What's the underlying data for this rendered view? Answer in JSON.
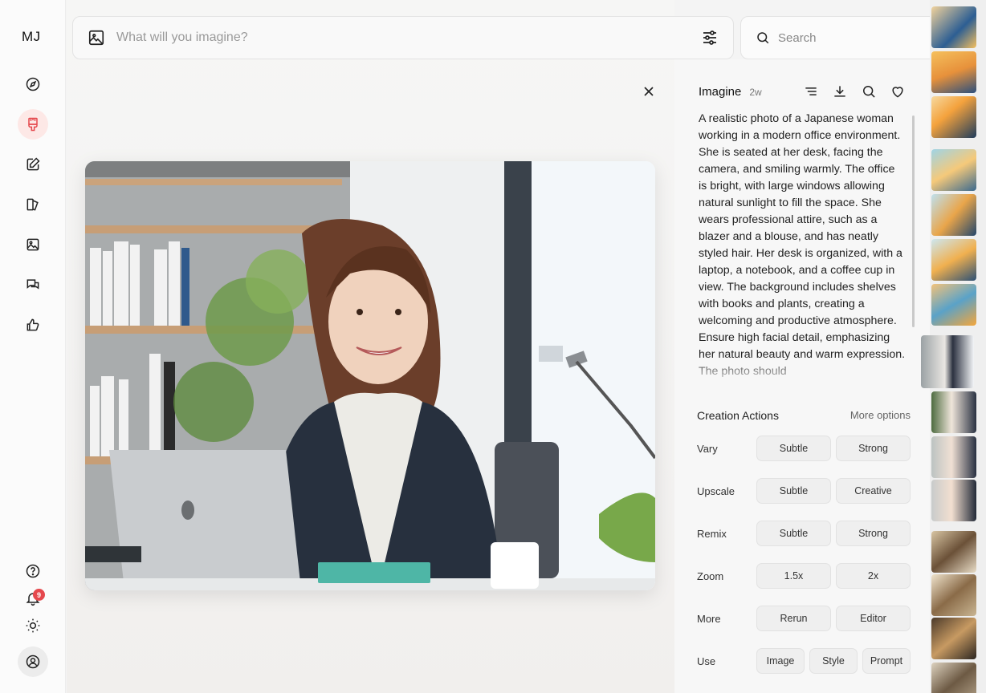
{
  "app": {
    "logo": "MJ"
  },
  "nav": {
    "items": [
      {
        "name": "explore",
        "icon": "compass-icon"
      },
      {
        "name": "create",
        "icon": "paintbrush-icon",
        "active": true
      },
      {
        "name": "edit",
        "icon": "pencil-square-icon"
      },
      {
        "name": "personalize",
        "icon": "pages-icon"
      },
      {
        "name": "organize",
        "icon": "image-icon"
      },
      {
        "name": "chat",
        "icon": "chat-bubbles-icon"
      },
      {
        "name": "rank",
        "icon": "thumbs-up-icon"
      }
    ],
    "bottom": [
      {
        "name": "help",
        "icon": "help-circle-icon"
      },
      {
        "name": "notifications",
        "icon": "bell-icon",
        "badge": "9"
      },
      {
        "name": "theme",
        "icon": "sun-icon"
      },
      {
        "name": "account",
        "icon": "user-circle-icon"
      }
    ]
  },
  "imagine_bar": {
    "placeholder": "What will you imagine?"
  },
  "search": {
    "placeholder": "Search"
  },
  "detail": {
    "title": "Imagine",
    "age": "2w",
    "prompt": "A realistic photo of a Japanese woman working in a modern office environment. She is seated at her desk, facing the camera, and smiling warmly. The office is bright, with large windows allowing natural sunlight to fill the space. She wears professional attire, such as a blazer and a blouse, and has neatly styled hair. Her desk is organized, with a laptop, a notebook, and a coffee cup in view. The background includes shelves with books and plants, creating a welcoming and productive atmosphere. Ensure high facial detail, emphasizing her natural beauty and warm expression. The photo should"
  },
  "creation_actions": {
    "title": "Creation Actions",
    "more_options": "More options",
    "rows": [
      {
        "label": "Vary",
        "buttons": [
          "Subtle",
          "Strong"
        ]
      },
      {
        "label": "Upscale",
        "buttons": [
          "Subtle",
          "Creative"
        ]
      },
      {
        "label": "Remix",
        "buttons": [
          "Subtle",
          "Strong"
        ]
      },
      {
        "label": "Zoom",
        "buttons": [
          "1.5x",
          "2x"
        ]
      },
      {
        "label": "More",
        "buttons": [
          "Rerun",
          "Editor"
        ]
      },
      {
        "label": "Use",
        "buttons": [
          "Image",
          "Style",
          "Prompt"
        ]
      }
    ]
  },
  "colors": {
    "accent": "#e5484d",
    "active_bg": "#fde8e6"
  }
}
